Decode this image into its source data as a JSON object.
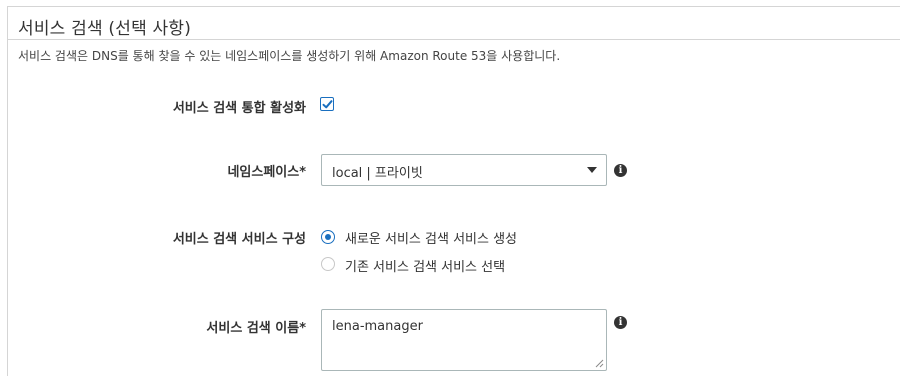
{
  "section": {
    "title": "서비스 검색 (선택 사항)",
    "description": "서비스 검색은 DNS를 통해 찾을 수 있는 네임스페이스를 생성하기 위해 Amazon Route 53을 사용합니다."
  },
  "enable_integration": {
    "label": "서비스 검색 통합 활성화",
    "checked": true
  },
  "namespace": {
    "label": "네임스페이스*",
    "selected_value": "local | 프라이빗",
    "info_icon": "info-icon"
  },
  "service_config": {
    "label": "서비스 검색 서비스 구성",
    "options": [
      {
        "label": "새로운 서비스 검색 서비스 생성",
        "selected": true
      },
      {
        "label": "기존 서비스 검색 서비스 선택",
        "selected": false
      }
    ]
  },
  "service_name": {
    "label": "서비스 검색 이름*",
    "value": "lena-manager",
    "info_icon": "info-icon"
  },
  "colors": {
    "accent": "#1a6fbf",
    "border": "#aab7b8",
    "text": "#333333"
  }
}
